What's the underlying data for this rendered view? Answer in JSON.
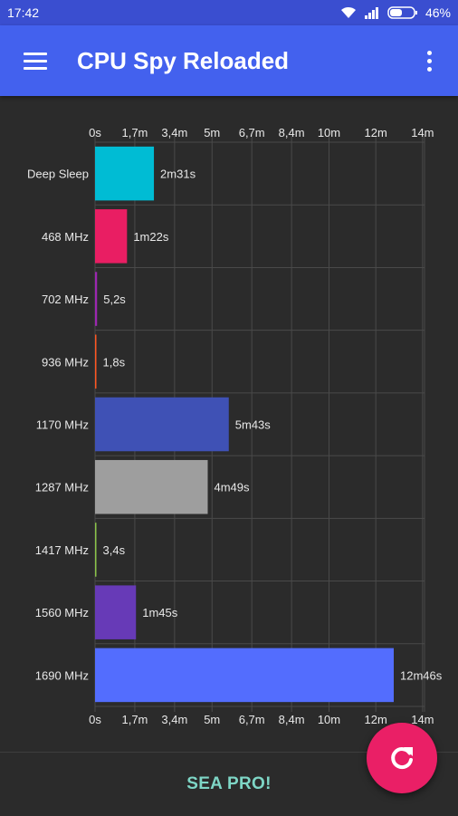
{
  "status_bar": {
    "time": "17:42",
    "battery": "46%"
  },
  "app_bar": {
    "title": "CPU Spy Reloaded"
  },
  "footer": {
    "label": "SEA PRO!"
  },
  "colors": {
    "app_bar": "#4361ee",
    "status_bar": "#3a4ed0",
    "background": "#2b2b2b",
    "fab": "#ea1f66",
    "footer_text": "#7ed6c6"
  },
  "chart_data": {
    "type": "bar",
    "orientation": "horizontal",
    "categories": [
      "Deep Sleep",
      "468 MHz",
      "702 MHz",
      "936 MHz",
      "1170 MHz",
      "1287 MHz",
      "1417 MHz",
      "1560 MHz",
      "1690 MHz"
    ],
    "values_seconds": [
      151,
      82,
      5.2,
      1.8,
      343,
      289,
      3.4,
      105,
      766
    ],
    "value_labels": [
      "2m31s",
      "1m22s",
      "5,2s",
      "1,8s",
      "5m43s",
      "4m49s",
      "3,4s",
      "1m45s",
      "12m46s"
    ],
    "bar_colors": [
      "#00bcd4",
      "#e91e63",
      "#9c27b0",
      "#ff5722",
      "#3f51b5",
      "#9e9e9e",
      "#8bc34a",
      "#673ab7",
      "#536dfe"
    ],
    "x_ticks": [
      "0s",
      "1,7m",
      "3,4m",
      "5m",
      "6,7m",
      "8,4m",
      "10m",
      "12m",
      "14m"
    ],
    "x_tick_seconds": [
      0,
      102,
      204,
      300,
      402,
      504,
      600,
      720,
      840
    ],
    "grid": true
  }
}
